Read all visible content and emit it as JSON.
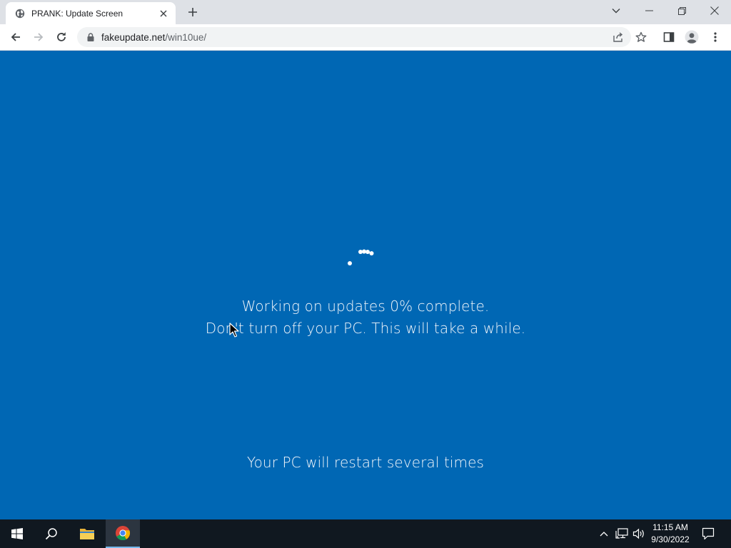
{
  "browser": {
    "tab_title": "PRANK: Update Screen",
    "url_host": "fakeupdate.net",
    "url_path": "/win10ue/"
  },
  "page": {
    "progress_percent": 0,
    "line1": "Working on updates  0% complete.",
    "line2": "Don't turn off your PC. This will take a while.",
    "line3": "Your PC will restart several times",
    "background_color": "#0067b4"
  },
  "taskbar": {
    "time": "11:15 AM",
    "date": "9/30/2022"
  }
}
